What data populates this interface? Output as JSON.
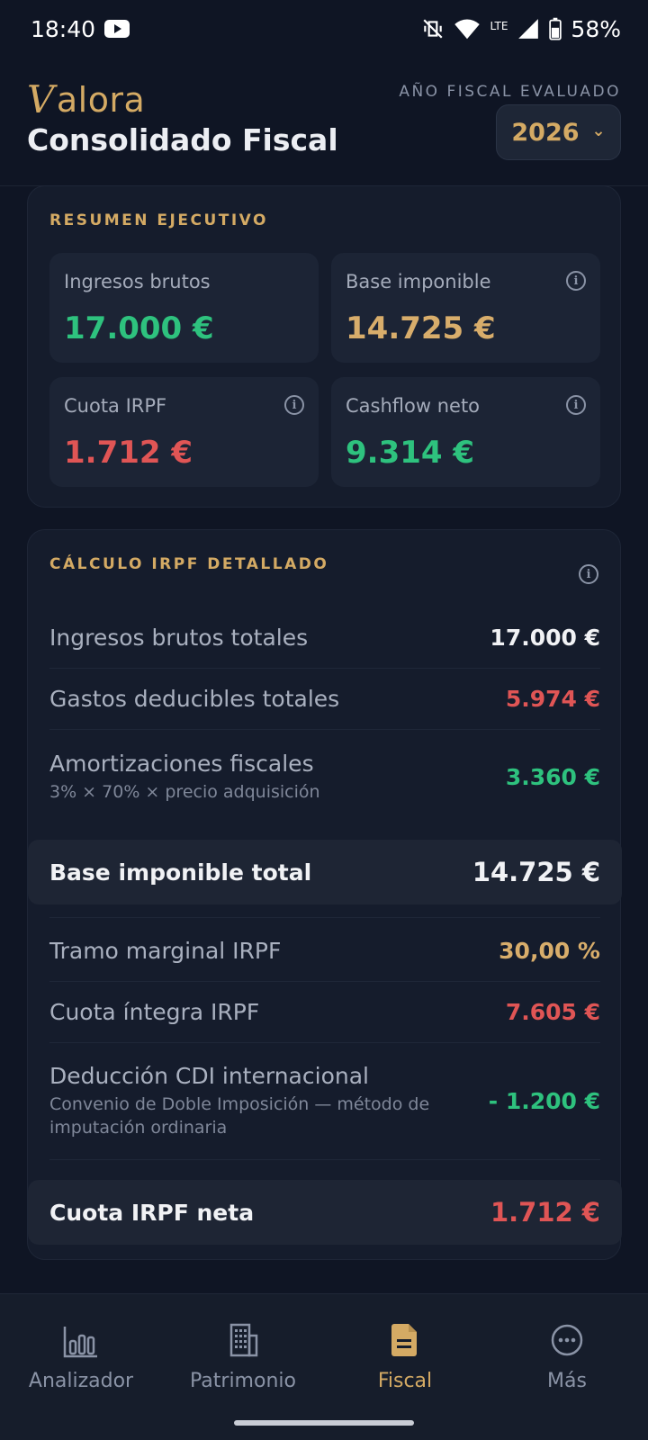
{
  "status": {
    "time": "18:40",
    "network": "LTE",
    "battery": "58%"
  },
  "header": {
    "logo": "alora",
    "logo_v": "V",
    "title": "Consolidado Fiscal",
    "year_label": "AÑO FISCAL EVALUADO",
    "year": "2026"
  },
  "summary": {
    "title": "RESUMEN EJECUTIVO",
    "tiles": [
      {
        "label": "Ingresos brutos",
        "value": "17.000 €",
        "color": "#2ec27e",
        "has_info": false
      },
      {
        "label": "Base imponible",
        "value": "14.725 €",
        "color": "#d8ad6b",
        "has_info": true
      },
      {
        "label": "Cuota IRPF",
        "value": "1.712 €",
        "color": "#e05555",
        "has_info": true
      },
      {
        "label": "Cashflow neto",
        "value": "9.314 €",
        "color": "#2ec27e",
        "has_info": true
      }
    ]
  },
  "irpf": {
    "title": "CÁLCULO IRPF DETALLADO",
    "rows": [
      {
        "label": "Ingresos brutos totales",
        "value": "17.000 €"
      },
      {
        "label": "Gastos deducibles totales",
        "value": "5.974 €"
      },
      {
        "label": "Amortizaciones fiscales",
        "sub": "3% × 70% × precio adquisición",
        "value": "3.360 €"
      }
    ],
    "total1": {
      "label": "Base imponible total",
      "value": "14.725 €"
    },
    "rows2": [
      {
        "label": "Tramo marginal IRPF",
        "value": "30,00 %"
      },
      {
        "label": "Cuota íntegra IRPF",
        "value": "7.605 €"
      },
      {
        "label": "Deducción CDI internacional",
        "sub": "Convenio de Doble Imposición — método de imputación ordinaria",
        "value": "- 1.200 €"
      }
    ],
    "total2": {
      "label": "Cuota IRPF neta",
      "value": "1.712 €"
    }
  },
  "nav": [
    {
      "label": "Analizador",
      "icon": "bar-chart-icon"
    },
    {
      "label": "Patrimonio",
      "icon": "building-icon"
    },
    {
      "label": "Fiscal",
      "icon": "document-icon",
      "active": true
    },
    {
      "label": "Más",
      "icon": "more-icon"
    }
  ],
  "colors": {
    "accent": "#d4aa64",
    "positive": "#2ec27e",
    "negative": "#e05555",
    "background": "#0f1524"
  }
}
